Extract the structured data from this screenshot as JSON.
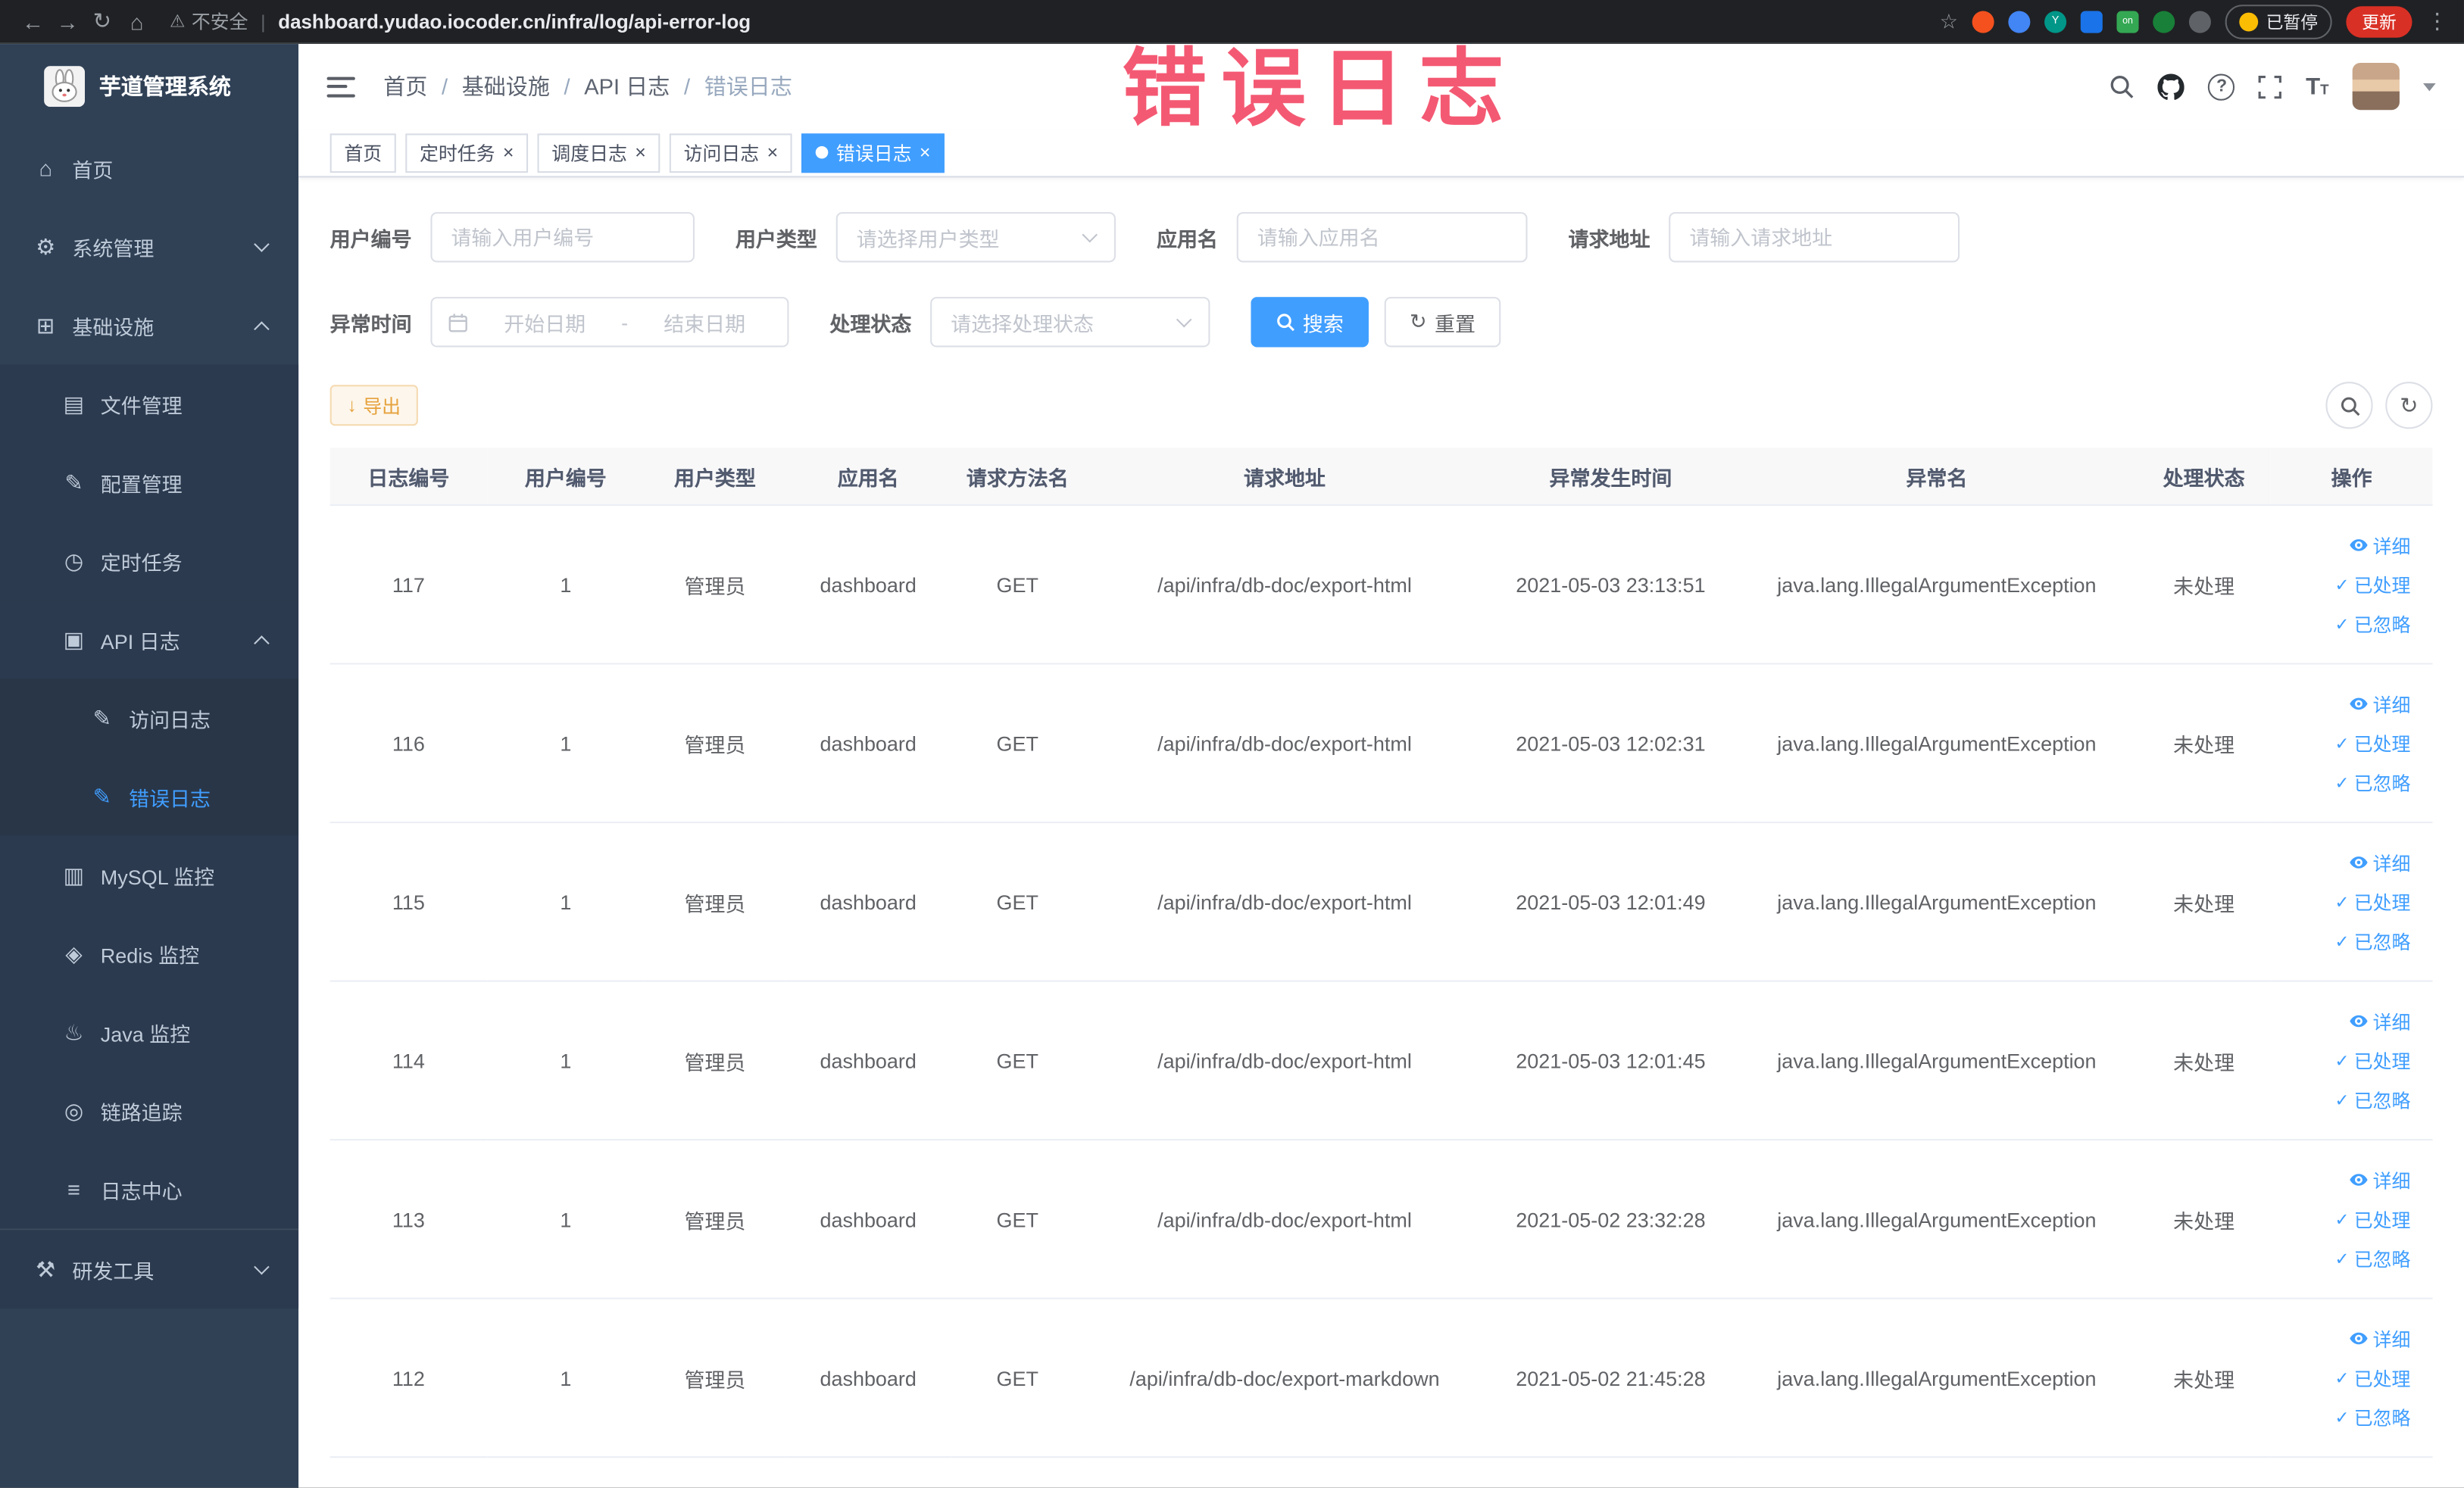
{
  "colors": {
    "accent": "#409eff",
    "sidebar_bg": "#304156",
    "warning": "#e6a23c",
    "annotation_pink": "#f4516c",
    "update_red": "#d93025"
  },
  "icons": {
    "back": "←",
    "forward": "→",
    "reload": "↻",
    "home_nav": "⌂",
    "warning": "⚠",
    "star": "☆",
    "kebab": "⋮",
    "close": "×",
    "caret_down": "▾",
    "menu_home": "⌂",
    "menu_system": "⚙",
    "menu_infra": "⊞",
    "menu_file": "▤",
    "menu_config": "✎",
    "menu_job": "◷",
    "menu_api_log": "▣",
    "menu_doc": "✎",
    "menu_mysql": "▥",
    "menu_redis": "◈",
    "menu_java": "♨",
    "menu_trace": "◎",
    "menu_log_center": "≡",
    "menu_dev": "⚒",
    "download": "↓",
    "refresh": "↻",
    "check": "✓",
    "ext_on": "on",
    "ext_y": "Y"
  },
  "browser": {
    "security_label": "不安全",
    "url": "dashboard.yudao.iocoder.cn/infra/log/api-error-log",
    "paused_label": "已暂停",
    "update_label": "更新"
  },
  "annotation": {
    "text": "错误日志"
  },
  "sidebar": {
    "logo_title": "芋道管理系统",
    "items": {
      "home": "首页",
      "system": "系统管理",
      "infra": "基础设施",
      "file": "文件管理",
      "config": "配置管理",
      "job": "定时任务",
      "api_log": "API 日志",
      "access_log": "访问日志",
      "error_log": "错误日志",
      "mysql": "MySQL 监控",
      "redis": "Redis 监控",
      "java": "Java 监控",
      "trace": "链路追踪",
      "log_center": "日志中心",
      "dev_tool": "研发工具"
    }
  },
  "header": {
    "breadcrumb": [
      "首页",
      "基础设施",
      "API 日志",
      "错误日志"
    ],
    "breadcrumb_separator": "/"
  },
  "tags": [
    {
      "label": "首页"
    },
    {
      "label": "定时任务"
    },
    {
      "label": "调度日志"
    },
    {
      "label": "访问日志"
    },
    {
      "label": "错误日志",
      "active": true
    }
  ],
  "filters": {
    "user_id_label": "用户编号",
    "user_id_placeholder": "请输入用户编号",
    "user_type_label": "用户类型",
    "user_type_placeholder": "请选择用户类型",
    "app_name_label": "应用名",
    "app_name_placeholder": "请输入应用名",
    "request_url_label": "请求地址",
    "request_url_placeholder": "请输入请求地址",
    "exception_time_label": "异常时间",
    "date_start_placeholder": "开始日期",
    "date_separator": "-",
    "date_end_placeholder": "结束日期",
    "process_status_label": "处理状态",
    "process_status_placeholder": "请选择处理状态",
    "search_label": "搜索",
    "reset_label": "重置"
  },
  "toolbar": {
    "export_label": "导出"
  },
  "table": {
    "columns": [
      "日志编号",
      "用户编号",
      "用户类型",
      "应用名",
      "请求方法名",
      "请求地址",
      "异常发生时间",
      "异常名",
      "处理状态",
      "操作"
    ],
    "actions": {
      "detail": "详细",
      "processed": "已处理",
      "ignored": "已忽略"
    },
    "rows": [
      {
        "id": "117",
        "user_id": "1",
        "user_type": "管理员",
        "app": "dashboard",
        "method": "GET",
        "url": "/api/infra/db-doc/export-html",
        "time": "2021-05-03 23:13:51",
        "exception": "java.lang.IllegalArgumentException",
        "status": "未处理"
      },
      {
        "id": "116",
        "user_id": "1",
        "user_type": "管理员",
        "app": "dashboard",
        "method": "GET",
        "url": "/api/infra/db-doc/export-html",
        "time": "2021-05-03 12:02:31",
        "exception": "java.lang.IllegalArgumentException",
        "status": "未处理"
      },
      {
        "id": "115",
        "user_id": "1",
        "user_type": "管理员",
        "app": "dashboard",
        "method": "GET",
        "url": "/api/infra/db-doc/export-html",
        "time": "2021-05-03 12:01:49",
        "exception": "java.lang.IllegalArgumentException",
        "status": "未处理"
      },
      {
        "id": "114",
        "user_id": "1",
        "user_type": "管理员",
        "app": "dashboard",
        "method": "GET",
        "url": "/api/infra/db-doc/export-html",
        "time": "2021-05-03 12:01:45",
        "exception": "java.lang.IllegalArgumentException",
        "status": "未处理"
      },
      {
        "id": "113",
        "user_id": "1",
        "user_type": "管理员",
        "app": "dashboard",
        "method": "GET",
        "url": "/api/infra/db-doc/export-html",
        "time": "2021-05-02 23:32:28",
        "exception": "java.lang.IllegalArgumentException",
        "status": "未处理"
      },
      {
        "id": "112",
        "user_id": "1",
        "user_type": "管理员",
        "app": "dashboard",
        "method": "GET",
        "url": "/api/infra/db-doc/export-markdown",
        "time": "2021-05-02 21:45:28",
        "exception": "java.lang.IllegalArgumentException",
        "status": "未处理"
      }
    ]
  }
}
